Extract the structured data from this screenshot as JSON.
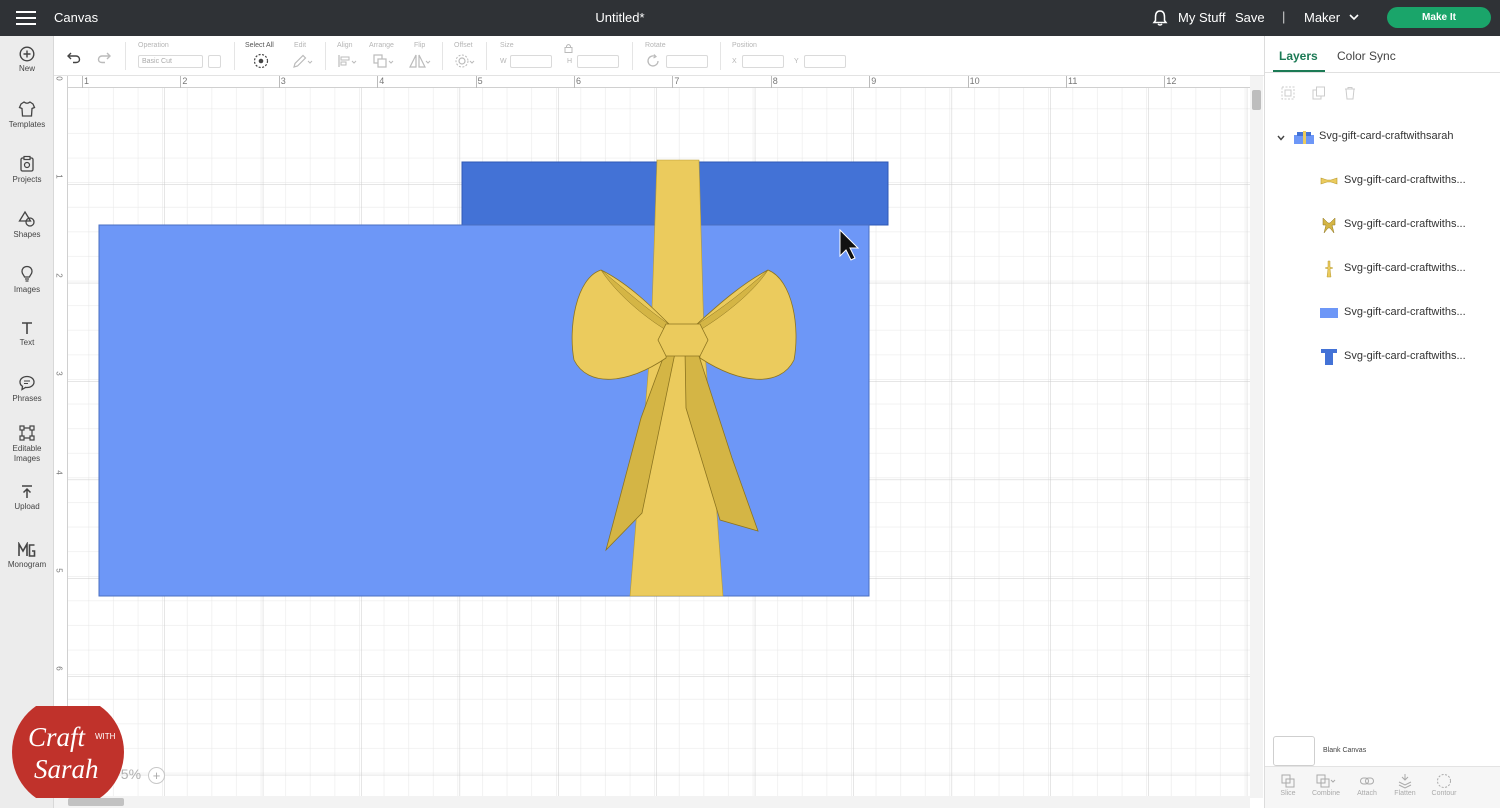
{
  "header": {
    "app_title": "Canvas",
    "doc_title": "Untitled*",
    "my_stuff": "My Stuff",
    "save": "Save",
    "separator": "|",
    "machine": "Maker",
    "make_it": "Make It"
  },
  "sidebar": {
    "items": [
      {
        "label": "New",
        "icon": "plus-circle-icon"
      },
      {
        "label": "Templates",
        "icon": "shirt-icon"
      },
      {
        "label": "Projects",
        "icon": "projects-icon"
      },
      {
        "label": "Shapes",
        "icon": "shapes-icon"
      },
      {
        "label": "Images",
        "icon": "lightbulb-icon"
      },
      {
        "label": "Text",
        "icon": "text-icon"
      },
      {
        "label": "Phrases",
        "icon": "speech-bubble-icon"
      },
      {
        "label": "Editable Images",
        "icon": "editable-images-icon"
      },
      {
        "label": "Upload",
        "icon": "upload-icon"
      },
      {
        "label": "Monogram",
        "icon": "monogram-icon"
      }
    ]
  },
  "toolbar": {
    "operation_label": "Operation",
    "operation_value": "Basic Cut",
    "select_all": "Select All",
    "edit": "Edit",
    "align": "Align",
    "arrange": "Arrange",
    "flip": "Flip",
    "offset": "Offset",
    "size": "Size",
    "w": "W",
    "h": "H",
    "rotate": "Rotate",
    "position": "Position",
    "x": "X",
    "y": "Y"
  },
  "rulers": {
    "top": [
      "1",
      "2",
      "3",
      "4",
      "5",
      "6",
      "7",
      "8",
      "9",
      "10",
      "11",
      "12"
    ],
    "left": [
      "0",
      "1",
      "2",
      "3",
      "4",
      "5",
      "6"
    ]
  },
  "canvas": {
    "zoom": "75%",
    "colors": {
      "lid": "#4372d6",
      "box": "#6d97f7",
      "ribbon": "#ebcb5d",
      "bow_shadow": "#d4b545"
    }
  },
  "panel": {
    "tabs": [
      "Layers",
      "Color Sync"
    ],
    "group_name": "Svg-gift-card-craftwithsarah",
    "layers": [
      {
        "name": "Svg-gift-card-craftwiths...",
        "icon": "bow-knot-icon",
        "color": "#ebcb5d"
      },
      {
        "name": "Svg-gift-card-craftwiths...",
        "icon": "bow-tails-icon",
        "color": "#d4b545"
      },
      {
        "name": "Svg-gift-card-craftwiths...",
        "icon": "ribbon-icon",
        "color": "#ebcb5d"
      },
      {
        "name": "Svg-gift-card-craftwiths...",
        "icon": "box-rect-icon",
        "color": "#6d97f7"
      },
      {
        "name": "Svg-gift-card-craftwiths...",
        "icon": "lid-icon",
        "color": "#4372d6"
      }
    ],
    "blank_canvas": "Blank Canvas",
    "bottom_tools": [
      "Slice",
      "Combine",
      "Attach",
      "Flatten",
      "Contour"
    ]
  },
  "watermark": {
    "line1": "Craft",
    "with": "WITH",
    "line2": "Sarah"
  }
}
